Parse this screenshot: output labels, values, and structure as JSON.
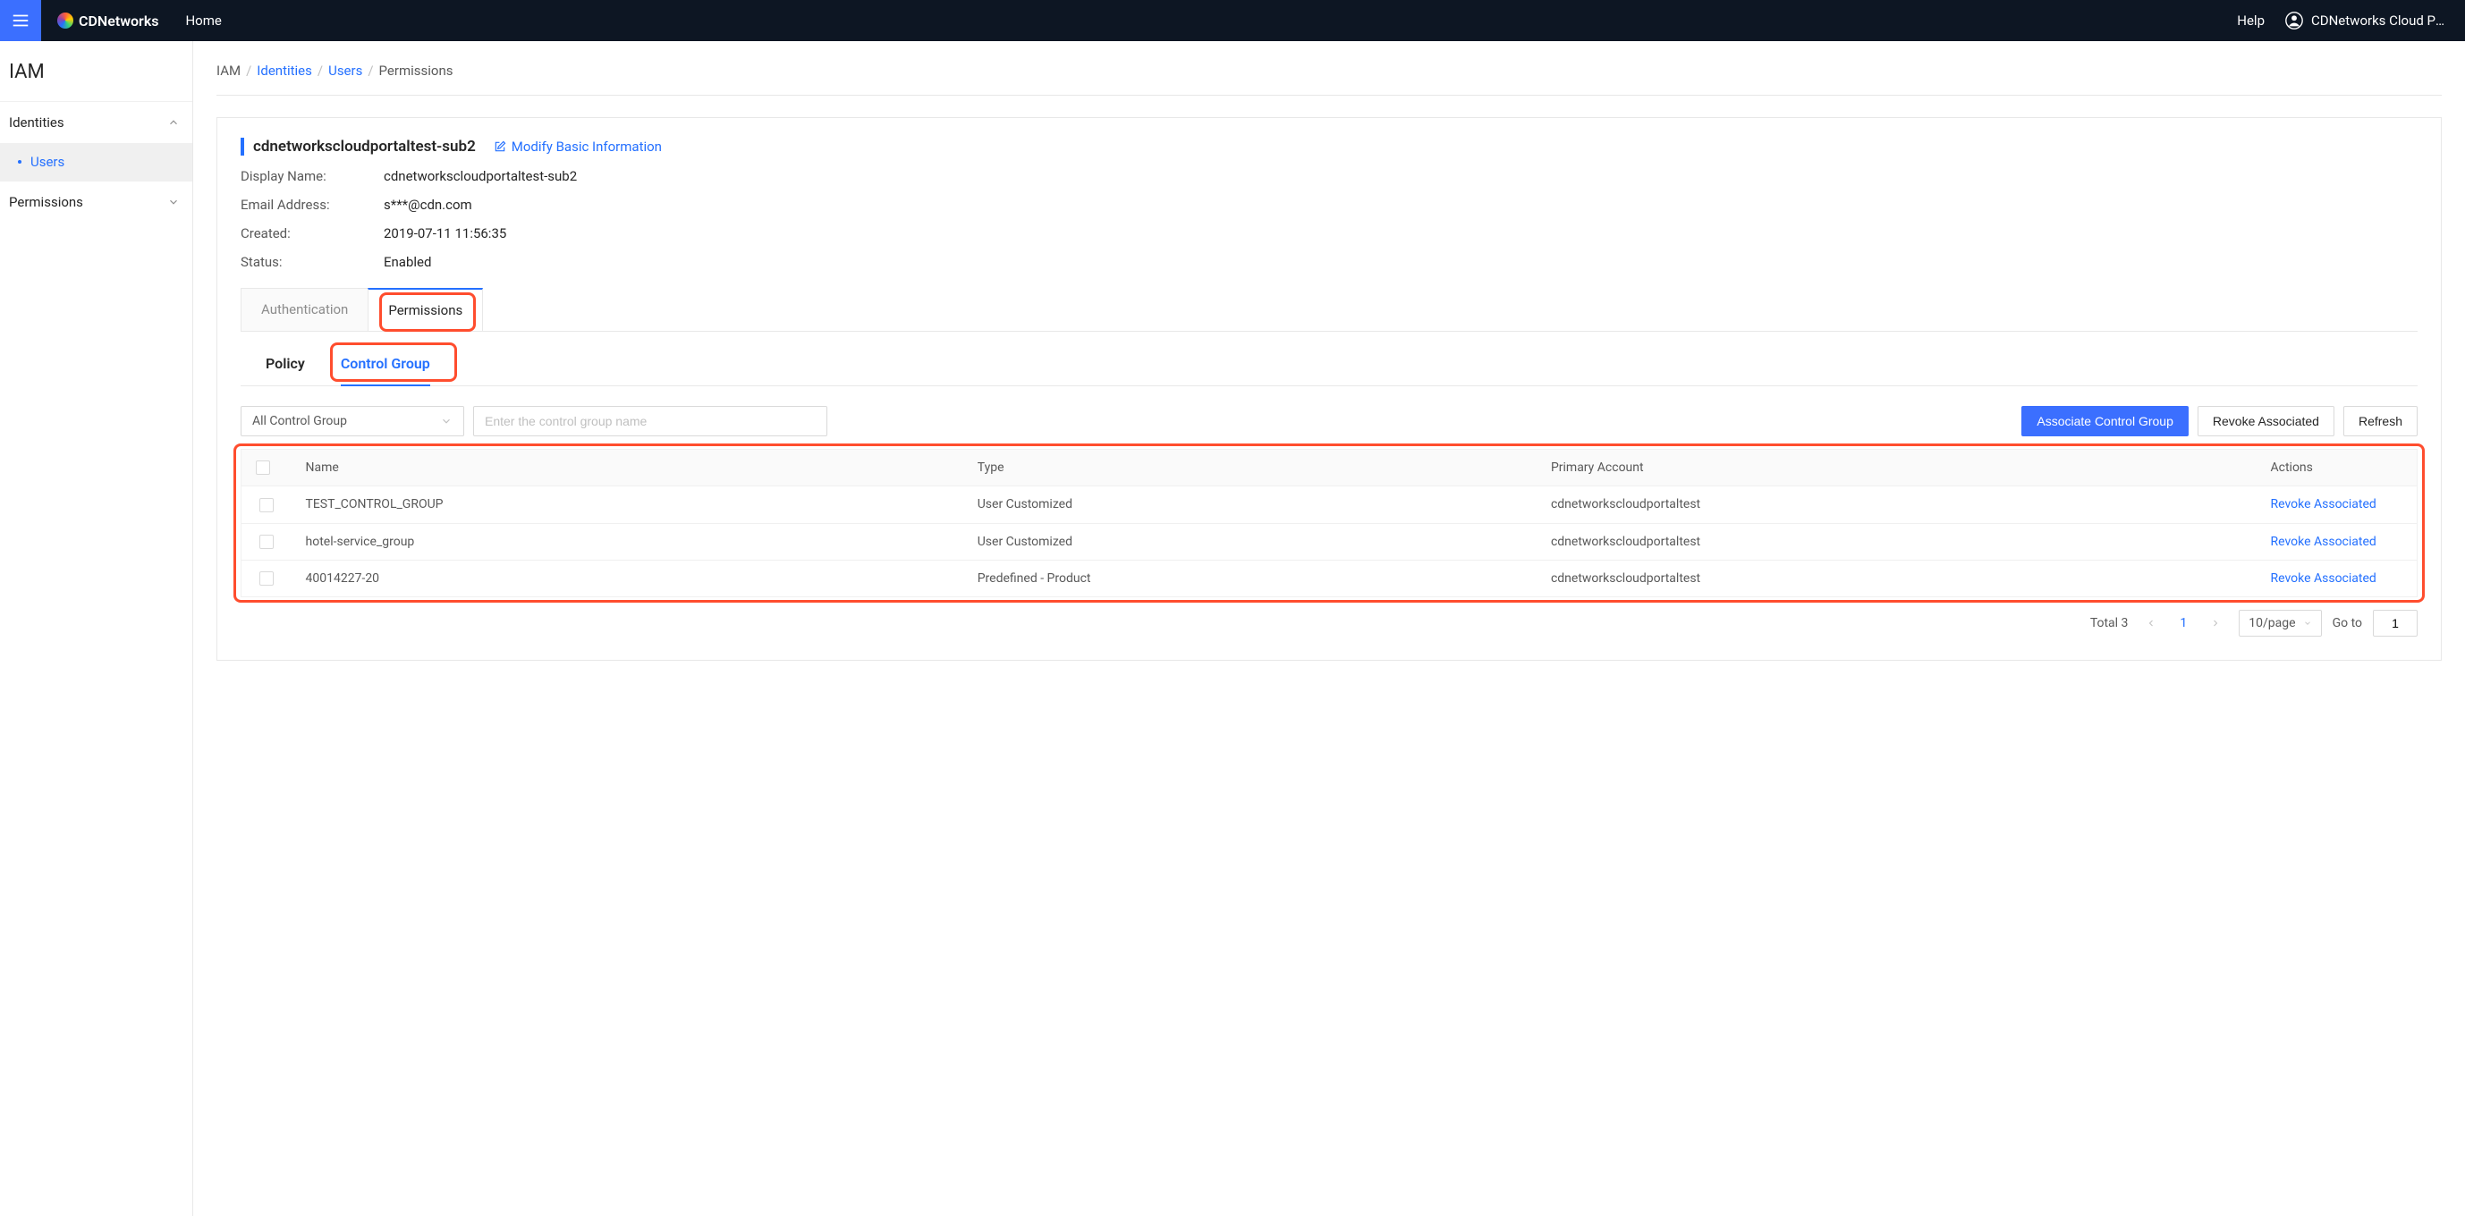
{
  "header": {
    "brand": "CDNetworks",
    "home": "Home",
    "help": "Help",
    "user_label": "CDNetworks Cloud Po..."
  },
  "sidebar": {
    "title": "IAM",
    "group_identities": {
      "label": "Identities",
      "expanded": true
    },
    "item_users": "Users",
    "group_permissions": {
      "label": "Permissions",
      "expanded": false
    }
  },
  "breadcrumb": {
    "root": "IAM",
    "identities": "Identities",
    "users": "Users",
    "current": "Permissions"
  },
  "detail": {
    "title": "cdnetworkscloudportaltest-sub2",
    "modify_label": "Modify Basic Information",
    "fields": {
      "display_name_label": "Display Name:",
      "display_name_value": "cdnetworkscloudportaltest-sub2",
      "email_label": "Email Address:",
      "email_value": "s***@cdn.com",
      "created_label": "Created:",
      "created_value": "2019-07-11 11:56:35",
      "status_label": "Status:",
      "status_value": "Enabled"
    }
  },
  "tabs_l1": {
    "authentication": "Authentication",
    "permissions": "Permissions"
  },
  "tabs_l2": {
    "policy": "Policy",
    "control_group": "Control Group"
  },
  "filters": {
    "select_value": "All Control Group",
    "input_placeholder": "Enter the control group name"
  },
  "buttons": {
    "associate": "Associate Control Group",
    "revoke": "Revoke Associated",
    "refresh": "Refresh"
  },
  "table": {
    "headers": {
      "name": "Name",
      "type": "Type",
      "primary_account": "Primary Account",
      "actions": "Actions"
    },
    "rows": [
      {
        "name": "TEST_CONTROL_GROUP",
        "type": "User Customized",
        "primary_account": "cdnetworkscloudportaltest",
        "action": "Revoke Associated"
      },
      {
        "name": "hotel-service_group",
        "type": "User Customized",
        "primary_account": "cdnetworkscloudportaltest",
        "action": "Revoke Associated"
      },
      {
        "name": "40014227-20",
        "type": "Predefined - Product",
        "primary_account": "cdnetworkscloudportaltest",
        "action": "Revoke Associated"
      }
    ]
  },
  "pagination": {
    "total_label": "Total 3",
    "current_page": "1",
    "page_size": "10/page",
    "goto_label": "Go to",
    "goto_value": "1"
  }
}
